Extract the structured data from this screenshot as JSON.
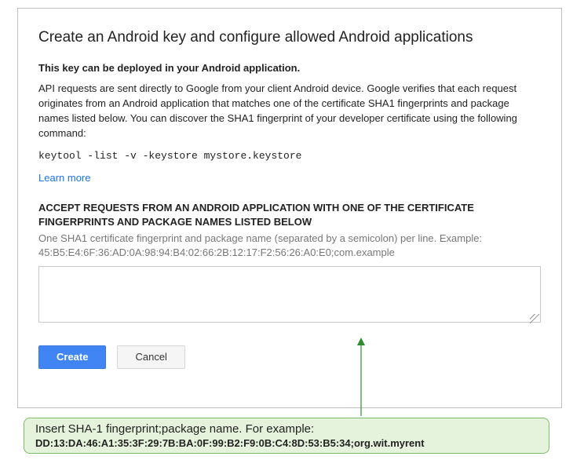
{
  "dialog": {
    "title": "Create an Android key and configure allowed Android applications",
    "bold_intro": "This key can be deployed in your Android application.",
    "description": "API requests are sent directly to Google from your client Android device. Google verifies that each request originates from an Android application that matches one of the certificate SHA1 fingerprints and package names listed below. You can discover the SHA1 fingerprint of your developer certificate using the following command:",
    "command": "keytool -list -v -keystore mystore.keystore",
    "learn_more": "Learn more",
    "section_heading": "ACCEPT REQUESTS FROM AN ANDROID APPLICATION WITH ONE OF THE CERTIFICATE FINGERPRINTS AND PACKAGE NAMES LISTED BELOW",
    "hint": "One SHA1 certificate fingerprint and package name (separated by a semicolon) per line. Example: 45:B5:E4:6F:36:AD:0A:98:94:B4:02:66:2B:12:17:F2:56:26:A0:E0;com.example",
    "textarea_value": "",
    "buttons": {
      "create": "Create",
      "cancel": "Cancel"
    }
  },
  "annotation": {
    "line1": "Insert SHA-1 fingerprint;package name. For example:",
    "line2": "DD:13:DA:46:A1:35:3F:29:7B:BA:0F:99:B2:F9:0B:C4:8D:53:B5:34;org.wit.myrent"
  },
  "colors": {
    "primary_button": "#4185f4",
    "link": "#1a73e8",
    "callout_bg": "#e6f3dc",
    "callout_border": "#7fb96a",
    "arrow": "#2e8b2e"
  }
}
